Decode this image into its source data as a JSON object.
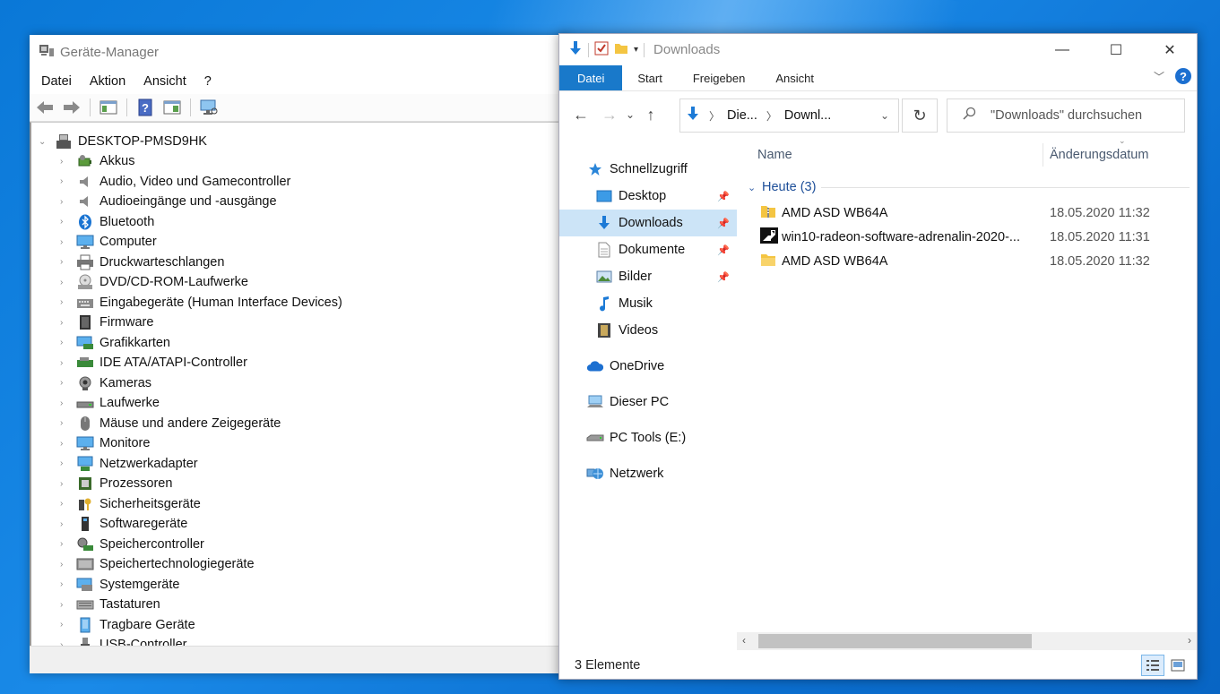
{
  "device_manager": {
    "title": "Geräte-Manager",
    "menu": [
      "Datei",
      "Aktion",
      "Ansicht",
      "?"
    ],
    "root": "DESKTOP-PMSD9HK",
    "items": [
      {
        "label": "Akkus",
        "icon": "battery-icon"
      },
      {
        "label": "Audio, Video und Gamecontroller",
        "icon": "speaker-icon"
      },
      {
        "label": "Audioeingänge und -ausgänge",
        "icon": "speaker-icon"
      },
      {
        "label": "Bluetooth",
        "icon": "bluetooth-icon"
      },
      {
        "label": "Computer",
        "icon": "monitor-icon"
      },
      {
        "label": "Druckwarteschlangen",
        "icon": "printer-icon"
      },
      {
        "label": "DVD/CD-ROM-Laufwerke",
        "icon": "disc-drive-icon"
      },
      {
        "label": "Eingabegeräte (Human Interface Devices)",
        "icon": "keyboard-hid-icon"
      },
      {
        "label": "Firmware",
        "icon": "chip-icon"
      },
      {
        "label": "Grafikkarten",
        "icon": "display-adapter-icon"
      },
      {
        "label": "IDE ATA/ATAPI-Controller",
        "icon": "ide-controller-icon"
      },
      {
        "label": "Kameras",
        "icon": "webcam-icon"
      },
      {
        "label": "Laufwerke",
        "icon": "disk-drive-icon"
      },
      {
        "label": "Mäuse und andere Zeigegeräte",
        "icon": "mouse-icon"
      },
      {
        "label": "Monitore",
        "icon": "monitor-icon"
      },
      {
        "label": "Netzwerkadapter",
        "icon": "network-adapter-icon"
      },
      {
        "label": "Prozessoren",
        "icon": "processor-icon"
      },
      {
        "label": "Sicherheitsgeräte",
        "icon": "security-key-icon"
      },
      {
        "label": "Softwaregeräte",
        "icon": "software-device-icon"
      },
      {
        "label": "Speichercontroller",
        "icon": "storage-controller-icon"
      },
      {
        "label": "Speichertechnologiegeräte",
        "icon": "storage-tech-icon"
      },
      {
        "label": "Systemgeräte",
        "icon": "system-device-icon"
      },
      {
        "label": "Tastaturen",
        "icon": "keyboard-icon"
      },
      {
        "label": "Tragbare Geräte",
        "icon": "portable-device-icon"
      },
      {
        "label": "USB-Controller",
        "icon": "usb-icon"
      }
    ]
  },
  "explorer": {
    "title": "Downloads",
    "ribbon_tabs": [
      "Datei",
      "Start",
      "Freigeben",
      "Ansicht"
    ],
    "address": {
      "seg1": "Die...",
      "seg2": "Downl..."
    },
    "search_placeholder": "\"Downloads\" durchsuchen",
    "sidebar": {
      "quick_access": "Schnellzugriff",
      "pinned": [
        "Desktop",
        "Downloads",
        "Dokumente",
        "Bilder"
      ],
      "unpinned": [
        "Musik",
        "Videos"
      ],
      "onedrive": "OneDrive",
      "this_pc": "Dieser PC",
      "drive": "PC Tools (E:)",
      "network": "Netzwerk"
    },
    "columns": {
      "name": "Name",
      "date": "Änderungsdatum"
    },
    "group": "Heute (3)",
    "files": [
      {
        "name": "AMD ASD WB64A",
        "date": "18.05.2020 11:32",
        "icon": "zip-folder-icon"
      },
      {
        "name": "win10-radeon-software-adrenalin-2020-...",
        "date": "18.05.2020 11:31",
        "icon": "amd-installer-icon"
      },
      {
        "name": "AMD ASD WB64A",
        "date": "18.05.2020 11:32",
        "icon": "folder-icon"
      }
    ],
    "status": "3 Elemente"
  },
  "colors": {
    "accent": "#1979ca",
    "selection": "#cce4f7",
    "desktop": "#0a78d7"
  }
}
